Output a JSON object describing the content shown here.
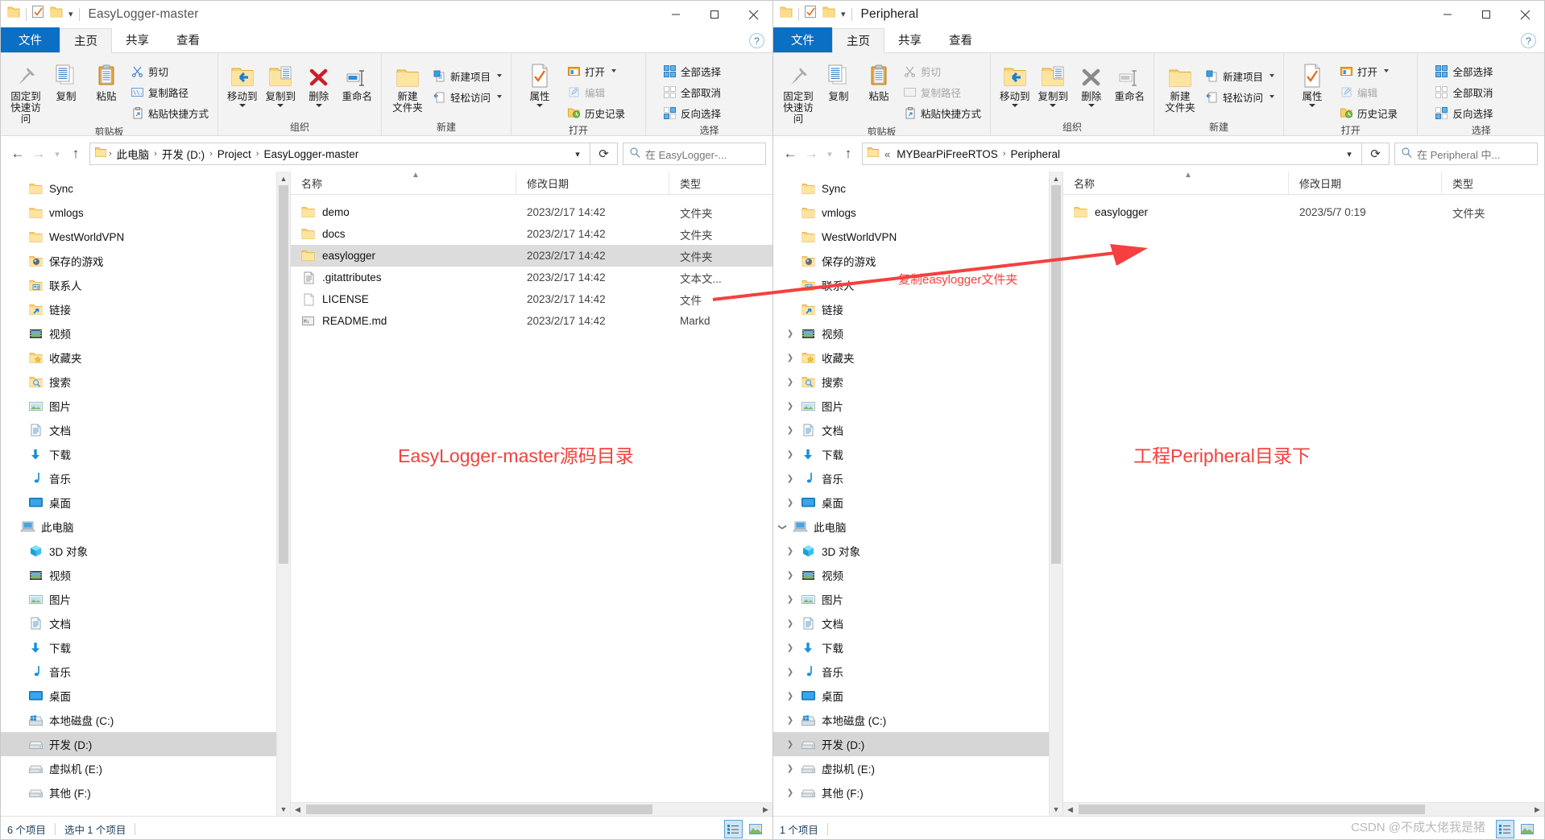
{
  "window1": {
    "title": "EasyLogger-master",
    "tabs": [
      {
        "label": "文件",
        "kind": "file"
      },
      {
        "label": "主页",
        "kind": "active"
      },
      {
        "label": "共享",
        "kind": "normal"
      },
      {
        "label": "查看",
        "kind": "normal"
      }
    ],
    "ribbon": {
      "groups": [
        {
          "title": "剪贴板",
          "big": [
            {
              "label": "固定到\n快速访问",
              "icon": "pin-icon"
            },
            {
              "label": "复制",
              "icon": "copy-icon"
            },
            {
              "label": "粘贴",
              "icon": "paste-icon"
            }
          ],
          "small": [
            {
              "label": "剪切",
              "icon": "scissors-icon"
            },
            {
              "label": "复制路径",
              "icon": "copy-path-icon"
            },
            {
              "label": "粘贴快捷方式",
              "icon": "paste-shortcut-icon"
            }
          ]
        },
        {
          "title": "组织",
          "big": [
            {
              "label": "移动到",
              "icon": "move-to-icon",
              "caret": true
            },
            {
              "label": "复制到",
              "icon": "copy-to-icon",
              "caret": true
            },
            {
              "label": "删除",
              "icon": "delete-icon",
              "caret": true
            },
            {
              "label": "重命名",
              "icon": "rename-icon"
            }
          ],
          "small": []
        },
        {
          "title": "新建",
          "big": [
            {
              "label": "新建\n文件夹",
              "icon": "new-folder-icon"
            }
          ],
          "small": [
            {
              "label": "新建项目",
              "icon": "new-item-icon",
              "caret": true
            },
            {
              "label": "轻松访问",
              "icon": "easy-access-icon",
              "caret": true
            }
          ]
        },
        {
          "title": "打开",
          "big": [
            {
              "label": "属性",
              "icon": "properties-icon",
              "caret": true
            }
          ],
          "small": [
            {
              "label": "打开",
              "icon": "open-icon",
              "caret": true
            },
            {
              "label": "编辑",
              "icon": "edit-icon",
              "dim": true
            },
            {
              "label": "历史记录",
              "icon": "history-icon"
            }
          ]
        },
        {
          "title": "选择",
          "big": [],
          "small": [
            {
              "label": "全部选择",
              "icon": "select-all-icon"
            },
            {
              "label": "全部取消",
              "icon": "select-none-icon"
            },
            {
              "label": "反向选择",
              "icon": "invert-selection-icon"
            }
          ]
        }
      ]
    },
    "address": {
      "crumbs": [
        "此电脑",
        "开发 (D:)",
        "Project",
        "EasyLogger-master"
      ],
      "search_placeholder": "在 EasyLogger-..."
    },
    "nav_items": [
      {
        "label": "Sync",
        "icon": "folder-icon",
        "expander": "none",
        "indent": 1
      },
      {
        "label": "vmlogs",
        "icon": "folder-icon",
        "expander": "none",
        "indent": 1
      },
      {
        "label": "WestWorldVPN",
        "icon": "folder-icon",
        "expander": "none",
        "indent": 1
      },
      {
        "label": "保存的游戏",
        "icon": "saved-games-icon",
        "expander": "none",
        "indent": 1
      },
      {
        "label": "联系人",
        "icon": "contacts-icon",
        "expander": "none",
        "indent": 1
      },
      {
        "label": "链接",
        "icon": "links-icon",
        "expander": "none",
        "indent": 1
      },
      {
        "label": "视频",
        "icon": "videos-icon",
        "expander": "none",
        "indent": 1
      },
      {
        "label": "收藏夹",
        "icon": "favorites-icon",
        "expander": "none",
        "indent": 1
      },
      {
        "label": "搜索",
        "icon": "searches-icon",
        "expander": "none",
        "indent": 1
      },
      {
        "label": "图片",
        "icon": "pictures-icon",
        "expander": "none",
        "indent": 1
      },
      {
        "label": "文档",
        "icon": "documents-icon",
        "expander": "none",
        "indent": 1
      },
      {
        "label": "下载",
        "icon": "downloads-icon",
        "expander": "none",
        "indent": 1
      },
      {
        "label": "音乐",
        "icon": "music-icon",
        "expander": "none",
        "indent": 1
      },
      {
        "label": "桌面",
        "icon": "desktop-icon",
        "expander": "none",
        "indent": 1
      },
      {
        "label": "此电脑",
        "icon": "this-pc-icon",
        "expander": "none",
        "indent": 0
      },
      {
        "label": "3D 对象",
        "icon": "3d-objects-icon",
        "expander": "none",
        "indent": 1
      },
      {
        "label": "视频",
        "icon": "videos-icon",
        "expander": "none",
        "indent": 1
      },
      {
        "label": "图片",
        "icon": "pictures-icon",
        "expander": "none",
        "indent": 1
      },
      {
        "label": "文档",
        "icon": "documents-icon",
        "expander": "none",
        "indent": 1
      },
      {
        "label": "下载",
        "icon": "downloads-icon",
        "expander": "none",
        "indent": 1
      },
      {
        "label": "音乐",
        "icon": "music-icon",
        "expander": "none",
        "indent": 1
      },
      {
        "label": "桌面",
        "icon": "desktop-icon",
        "expander": "none",
        "indent": 1
      },
      {
        "label": "本地磁盘 (C:)",
        "icon": "windows-drive-icon",
        "expander": "none",
        "indent": 1
      },
      {
        "label": "开发 (D:)",
        "icon": "drive-icon",
        "expander": "none",
        "indent": 1,
        "selected": true
      },
      {
        "label": "虚拟机 (E:)",
        "icon": "drive-icon",
        "expander": "none",
        "indent": 1
      },
      {
        "label": "其他 (F:)",
        "icon": "drive-icon",
        "expander": "none",
        "indent": 1
      }
    ],
    "columns": [
      "名称",
      "修改日期",
      "类型"
    ],
    "files": [
      {
        "name": "demo",
        "date": "2023/2/17 14:42",
        "type": "文件夹",
        "icon": "folder-icon"
      },
      {
        "name": "docs",
        "date": "2023/2/17 14:42",
        "type": "文件夹",
        "icon": "folder-icon"
      },
      {
        "name": "easylogger",
        "date": "2023/2/17 14:42",
        "type": "文件夹",
        "icon": "folder-icon",
        "selected": true
      },
      {
        "name": ".gitattributes",
        "date": "2023/2/17 14:42",
        "type": "文本文...",
        "icon": "textfile-icon"
      },
      {
        "name": "LICENSE",
        "date": "2023/2/17 14:42",
        "type": "文件",
        "icon": "genericfile-icon"
      },
      {
        "name": "README.md",
        "date": "2023/2/17 14:42",
        "type": "Markd",
        "icon": "markdown-icon"
      }
    ],
    "status": {
      "count": "6 个项目",
      "selection": "选中 1 个项目"
    }
  },
  "window2": {
    "title": "Peripheral",
    "tabs": [
      {
        "label": "文件",
        "kind": "file"
      },
      {
        "label": "主页",
        "kind": "active"
      },
      {
        "label": "共享",
        "kind": "normal"
      },
      {
        "label": "查看",
        "kind": "normal"
      }
    ],
    "address": {
      "crumbs": [
        "MYBearPiFreeRTOS",
        "Peripheral"
      ],
      "prefix": "«",
      "search_placeholder": "在 Peripheral 中..."
    },
    "nav_items": [
      {
        "label": "Sync",
        "icon": "folder-icon",
        "expander": "none",
        "indent": 1
      },
      {
        "label": "vmlogs",
        "icon": "folder-icon",
        "expander": "none",
        "indent": 1
      },
      {
        "label": "WestWorldVPN",
        "icon": "folder-icon",
        "expander": "none",
        "indent": 1
      },
      {
        "label": "保存的游戏",
        "icon": "saved-games-icon",
        "expander": "none",
        "indent": 1
      },
      {
        "label": "联系人",
        "icon": "contacts-icon",
        "expander": "none",
        "indent": 1
      },
      {
        "label": "链接",
        "icon": "links-icon",
        "expander": "none",
        "indent": 1
      },
      {
        "label": "视频",
        "icon": "videos-icon",
        "expander": "collapsed",
        "indent": 1
      },
      {
        "label": "收藏夹",
        "icon": "favorites-icon",
        "expander": "collapsed",
        "indent": 1
      },
      {
        "label": "搜索",
        "icon": "searches-icon",
        "expander": "collapsed",
        "indent": 1
      },
      {
        "label": "图片",
        "icon": "pictures-icon",
        "expander": "collapsed",
        "indent": 1
      },
      {
        "label": "文档",
        "icon": "documents-icon",
        "expander": "collapsed",
        "indent": 1
      },
      {
        "label": "下载",
        "icon": "downloads-icon",
        "expander": "collapsed",
        "indent": 1
      },
      {
        "label": "音乐",
        "icon": "music-icon",
        "expander": "collapsed",
        "indent": 1
      },
      {
        "label": "桌面",
        "icon": "desktop-icon",
        "expander": "collapsed",
        "indent": 1
      },
      {
        "label": "此电脑",
        "icon": "this-pc-icon",
        "expander": "expanded",
        "indent": 0
      },
      {
        "label": "3D 对象",
        "icon": "3d-objects-icon",
        "expander": "collapsed",
        "indent": 1
      },
      {
        "label": "视频",
        "icon": "videos-icon",
        "expander": "collapsed",
        "indent": 1
      },
      {
        "label": "图片",
        "icon": "pictures-icon",
        "expander": "collapsed",
        "indent": 1
      },
      {
        "label": "文档",
        "icon": "documents-icon",
        "expander": "collapsed",
        "indent": 1
      },
      {
        "label": "下载",
        "icon": "downloads-icon",
        "expander": "collapsed",
        "indent": 1
      },
      {
        "label": "音乐",
        "icon": "music-icon",
        "expander": "collapsed",
        "indent": 1
      },
      {
        "label": "桌面",
        "icon": "desktop-icon",
        "expander": "collapsed",
        "indent": 1
      },
      {
        "label": "本地磁盘 (C:)",
        "icon": "windows-drive-icon",
        "expander": "collapsed",
        "indent": 1
      },
      {
        "label": "开发 (D:)",
        "icon": "drive-icon",
        "expander": "collapsed",
        "indent": 1,
        "selected": true
      },
      {
        "label": "虚拟机 (E:)",
        "icon": "drive-icon",
        "expander": "collapsed",
        "indent": 1
      },
      {
        "label": "其他 (F:)",
        "icon": "drive-icon",
        "expander": "collapsed",
        "indent": 1
      }
    ],
    "columns": [
      "名称",
      "修改日期",
      "类型"
    ],
    "files": [
      {
        "name": "easylogger",
        "date": "2023/5/7 0:19",
        "type": "文件夹",
        "icon": "folder-icon"
      }
    ],
    "status": {
      "count": "1 个项目",
      "selection": ""
    }
  },
  "annotations": {
    "left_caption": "EasyLogger-master源码目录",
    "right_caption": "工程Peripheral目录下",
    "arrow_label": "复制easylogger文件夹",
    "color": "#f5403f"
  },
  "watermark": "CSDN @不成大佬我是猪"
}
